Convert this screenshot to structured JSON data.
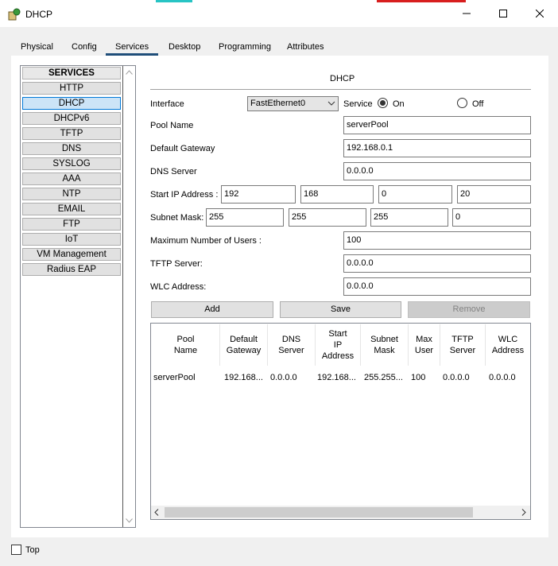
{
  "window": {
    "title": "DHCP"
  },
  "tabs": [
    {
      "label": "Physical"
    },
    {
      "label": "Config"
    },
    {
      "label": "Services"
    },
    {
      "label": "Desktop"
    },
    {
      "label": "Programming"
    },
    {
      "label": "Attributes"
    }
  ],
  "services": {
    "header": "SERVICES",
    "items": [
      "HTTP",
      "DHCP",
      "DHCPv6",
      "TFTP",
      "DNS",
      "SYSLOG",
      "AAA",
      "NTP",
      "EMAIL",
      "FTP",
      "IoT",
      "VM Management",
      "Radius EAP"
    ],
    "selected": "DHCP"
  },
  "dhcp": {
    "section_title": "DHCP",
    "interface_label": "Interface",
    "interface_value": "FastEthernet0",
    "service_label": "Service",
    "on_label": "On",
    "off_label": "Off",
    "pool_name_label": "Pool Name",
    "pool_name_value": "serverPool",
    "default_gateway_label": "Default Gateway",
    "default_gateway_value": "192.168.0.1",
    "dns_server_label": "DNS Server",
    "dns_server_value": "0.0.0.0",
    "start_ip_label": "Start IP Address :",
    "start_ip": [
      "192",
      "168",
      "0",
      "20"
    ],
    "subnet_mask_label": "Subnet Mask:",
    "subnet_mask": [
      "255",
      "255",
      "255",
      "0"
    ],
    "max_users_label": "Maximum Number of Users :",
    "max_users_value": "100",
    "tftp_label": "TFTP Server:",
    "tftp_value": "0.0.0.0",
    "wlc_label": "WLC Address:",
    "wlc_value": "0.0.0.0",
    "add_label": "Add",
    "save_label": "Save",
    "remove_label": "Remove"
  },
  "table": {
    "headers": [
      "Pool\nName",
      "Default\nGateway",
      "DNS\nServer",
      "Start\nIP\nAddress",
      "Subnet\nMask",
      "Max\nUser",
      "TFTP\nServer",
      "WLC\nAddress"
    ],
    "rows": [
      [
        "serverPool",
        "192.168...",
        "0.0.0.0",
        "192.168...",
        "255.255...",
        "100",
        "0.0.0.0",
        "0.0.0.0"
      ]
    ]
  },
  "footer": {
    "top_label": "Top"
  }
}
